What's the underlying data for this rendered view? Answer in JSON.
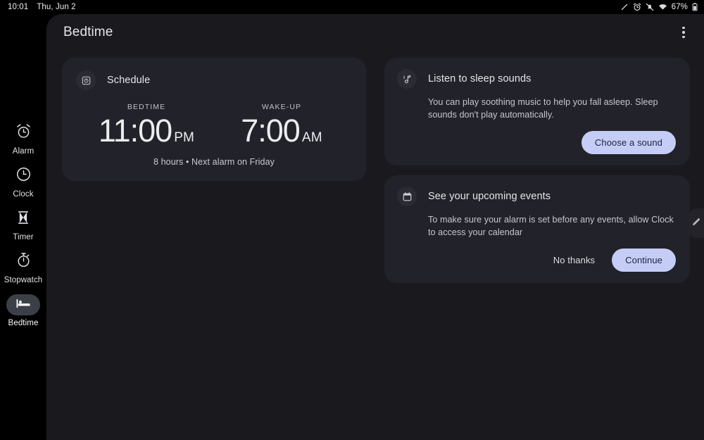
{
  "statusbar": {
    "time": "10:01",
    "date": "Thu, Jun 2",
    "battery_percent": "67%",
    "icons": [
      "pen-slash-icon",
      "alarm-set-icon",
      "notifications-muted-icon",
      "wifi-icon",
      "battery-icon"
    ]
  },
  "rail": {
    "items": [
      {
        "label": "Alarm",
        "icon": "alarm-icon",
        "selected": false
      },
      {
        "label": "Clock",
        "icon": "clock-icon",
        "selected": false
      },
      {
        "label": "Timer",
        "icon": "hourglass-icon",
        "selected": false
      },
      {
        "label": "Stopwatch",
        "icon": "stopwatch-icon",
        "selected": false
      },
      {
        "label": "Bedtime",
        "icon": "bed-icon",
        "selected": true
      }
    ]
  },
  "appbar": {
    "title": "Bedtime",
    "overflow_label": "More options"
  },
  "schedule_card": {
    "icon": "schedule-alarm-icon",
    "title": "Schedule",
    "bedtime": {
      "caption": "BEDTIME",
      "time": "11:00",
      "meridiem": "PM"
    },
    "wakeup": {
      "caption": "WAKE-UP",
      "time": "7:00",
      "meridiem": "AM"
    },
    "summary": "8 hours • Next alarm on Friday"
  },
  "sleep_sounds_card": {
    "icon": "music-note-icon",
    "title": "Listen to sleep sounds",
    "body": "You can play soothing music to help you fall asleep. Sleep sounds don't play automatically.",
    "primary_action": "Choose a sound"
  },
  "calendar_card": {
    "icon": "calendar-icon",
    "title": "See your upcoming events",
    "body": "To make sure your alarm is set before any events, allow Clock to access your calendar",
    "secondary_action": "No thanks",
    "primary_action": "Continue"
  },
  "edge_handle": {
    "icon": "pencil-edit-icon"
  },
  "colors": {
    "rail_background": "#000000",
    "surface_background": "#1a1a1e",
    "card_background": "#22222a",
    "accent_button": "#c5cdf6",
    "accent_button_text": "#1b2340",
    "selected_pill": "#3b4048",
    "primary_text": "#e6e6e9",
    "secondary_text": "#c6c7cd"
  }
}
